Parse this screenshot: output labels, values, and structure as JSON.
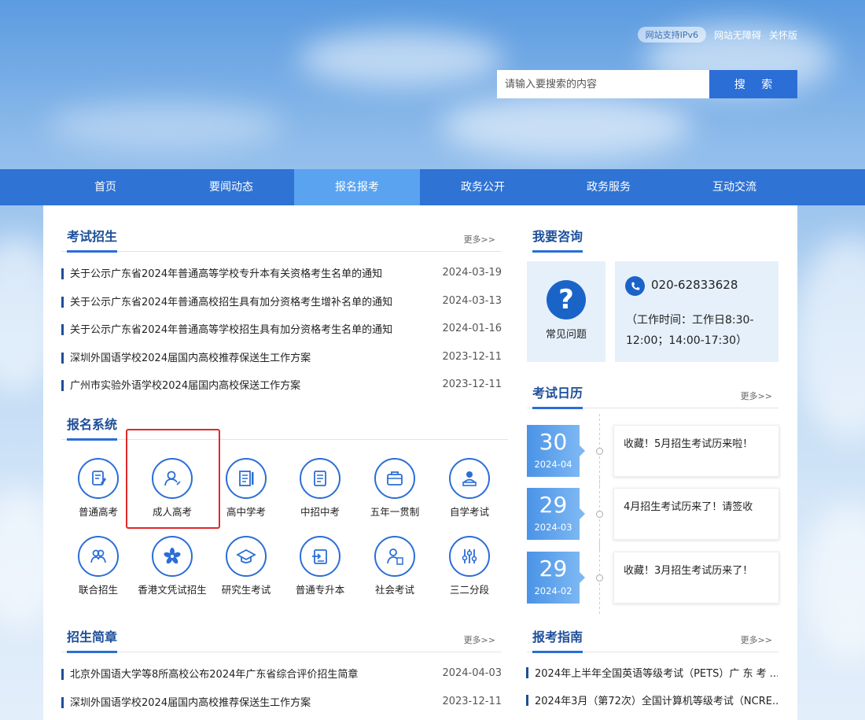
{
  "topbar": {
    "ipv6_badge": "网站支持IPv6",
    "links": [
      "网站无障碍",
      "关怀版"
    ]
  },
  "search": {
    "placeholder": "请输入要搜索的内容",
    "button": "搜 索"
  },
  "nav": {
    "items": [
      "首页",
      "要闻动态",
      "报名报考",
      "政务公开",
      "政务服务",
      "互动交流"
    ],
    "active_index": 2
  },
  "sections": {
    "exam_enrollment": {
      "title": "考试招生",
      "more": "更多>>",
      "items": [
        {
          "title": "关于公示广东省2024年普通高等学校专升本有关资格考生名单的通知",
          "date": "2024-03-19"
        },
        {
          "title": "关于公示广东省2024年普通高校招生具有加分资格考生增补名单的通知",
          "date": "2024-03-13"
        },
        {
          "title": "关于公示广东省2024年普通高等学校招生具有加分资格考生名单的通知",
          "date": "2024-01-16"
        },
        {
          "title": "深圳外国语学校2024届国内高校推荐保送生工作方案",
          "date": "2023-12-11"
        },
        {
          "title": "广州市实验外语学校2024届国内高校保送工作方案",
          "date": "2023-12-11"
        }
      ]
    },
    "registration_system": {
      "title": "报名系统",
      "items": [
        {
          "label": "普通高考",
          "icon": "gaokao-icon"
        },
        {
          "label": "成人高考",
          "icon": "adult-exam-icon"
        },
        {
          "label": "高中学考",
          "icon": "high-school-exam-icon"
        },
        {
          "label": "中招中考",
          "icon": "zhongkao-icon"
        },
        {
          "label": "五年一贯制",
          "icon": "five-year-icon"
        },
        {
          "label": "自学考试",
          "icon": "self-study-icon"
        },
        {
          "label": "联合招生",
          "icon": "joint-enrollment-icon"
        },
        {
          "label": "香港文凭试招生",
          "icon": "hong-kong-flower-icon"
        },
        {
          "label": "研究生考试",
          "icon": "graduate-cap-icon"
        },
        {
          "label": "普通专升本",
          "icon": "upgrade-icon"
        },
        {
          "label": "社会考试",
          "icon": "social-exam-icon"
        },
        {
          "label": "三二分段",
          "icon": "sliders-icon"
        }
      ],
      "highlighted": "成人高考"
    },
    "admission_brochure": {
      "title": "招生简章",
      "more": "更多>>",
      "items": [
        {
          "title": "北京外国语大学等8所高校公布2024年广东省综合评价招生简章",
          "date": "2024-04-03"
        },
        {
          "title": "深圳外国语学校2024届国内高校推荐保送生工作方案",
          "date": "2023-12-11"
        }
      ]
    },
    "consult": {
      "title": "我要咨询",
      "faq_label": "常见问题",
      "faq_icon": "?",
      "phone": "020-62833628",
      "work_time": "（工作时间：工作日8:30-12:00；14:00-17:30）"
    },
    "exam_calendar": {
      "title": "考试日历",
      "more": "更多>>",
      "items": [
        {
          "day": "30",
          "ym": "2024-04",
          "text": "收藏！5月招生考试历来啦！"
        },
        {
          "day": "29",
          "ym": "2024-03",
          "text": "4月招生考试历来了！请签收"
        },
        {
          "day": "29",
          "ym": "2024-02",
          "text": "收藏！3月招生考试历来了！"
        }
      ]
    },
    "exam_guide": {
      "title": "报考指南",
      "more": "更多>>",
      "items": [
        "2024年上半年全国英语等级考试（PETS）广 东 考 ...",
        "2024年3月（第72次）全国计算机等级考试（NCRE..."
      ]
    }
  },
  "colors": {
    "nav_bg": "#2f73d4",
    "nav_active": "#5aa3f0",
    "accent": "#2b6ed6",
    "title": "#1d4e99",
    "highlight": "#e02a2a"
  }
}
